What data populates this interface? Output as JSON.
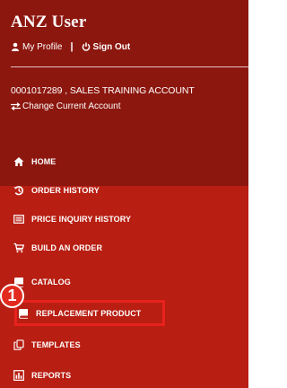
{
  "user": {
    "name": "ANZ User",
    "my_profile": "My Profile",
    "separator": "|",
    "sign_out": "Sign Out"
  },
  "account": {
    "current": "0001017289 , SALES TRAINING ACCOUNT",
    "change_label": "Change Current Account"
  },
  "menu": [
    {
      "label": "HOME",
      "icon": "home-icon"
    },
    {
      "label": "ORDER HISTORY",
      "icon": "history-icon"
    },
    {
      "label": "PRICE INQUIRY HISTORY",
      "icon": "list-icon"
    },
    {
      "label": "BUILD AN ORDER",
      "icon": "cart-icon"
    },
    {
      "label": "CATALOG",
      "icon": "book-icon"
    },
    {
      "label": "REPLACEMENT PRODUCT",
      "icon": "book-icon"
    },
    {
      "label": "TEMPLATES",
      "icon": "copy-icon"
    },
    {
      "label": "REPORTS",
      "icon": "chart-icon"
    }
  ],
  "annotation": {
    "step_number": "1",
    "highlighted_item": "REPLACEMENT PRODUCT"
  },
  "colors": {
    "header_bg": "#8c170f",
    "menu_bg": "#b81e12",
    "highlight": "#e8221e"
  }
}
